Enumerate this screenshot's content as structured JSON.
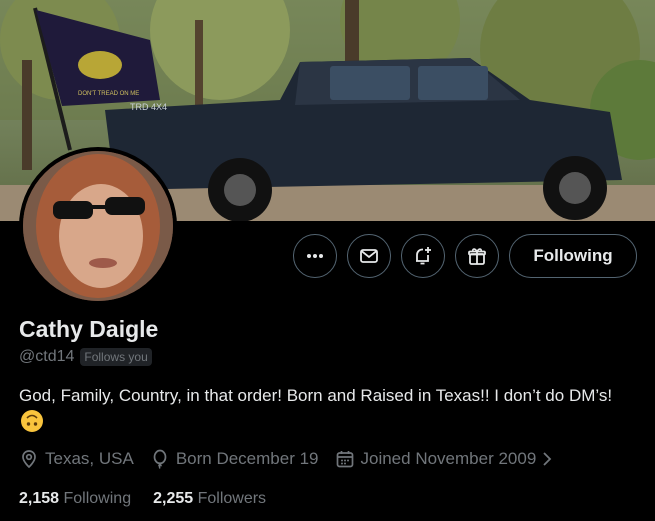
{
  "profile": {
    "name": "Cathy Daigle",
    "handle": "@ctd14",
    "follows_you": "Follows you",
    "bio_text": "God, Family, Country, in that order! Born and Raised in Texas!!       I don’t do DM’s!",
    "bio_emoji": "upside-down-face-emoji",
    "location": "Texas, USA",
    "birthday": "Born December 19",
    "joined": "Joined November 2009"
  },
  "banner": {
    "flag_text": "DON'T TREAD ON ME",
    "truck_badge": "TRD 4X4"
  },
  "actions": {
    "more_icon": "more-icon",
    "message_icon": "mail-icon",
    "notify_icon": "bell-plus-icon",
    "gift_icon": "gift-icon",
    "follow_label": "Following"
  },
  "stats": {
    "following_count": "2,158",
    "following_label": "Following",
    "followers_count": "2,255",
    "followers_label": "Followers"
  },
  "colors": {
    "background": "#000000",
    "text_primary": "#e7e9ea",
    "text_secondary": "#71767b",
    "border": "#536471"
  }
}
